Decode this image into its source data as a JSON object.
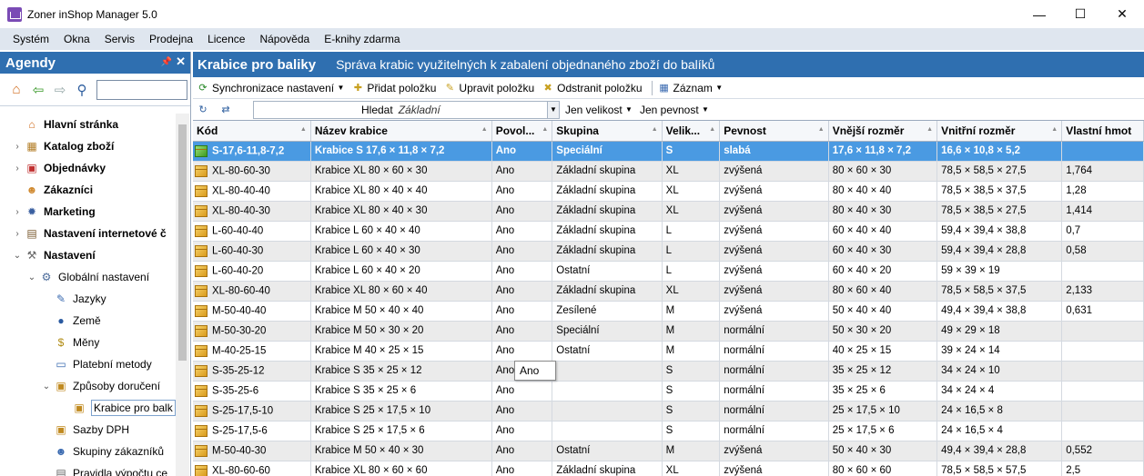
{
  "window": {
    "title": "Zoner inShop Manager 5.0",
    "minimize": "—",
    "maximize": "☐",
    "close": "✕"
  },
  "menu": [
    "Systém",
    "Okna",
    "Servis",
    "Prodejna",
    "Licence",
    "Nápověda",
    "E-knihy zdarma"
  ],
  "left_panel": {
    "title": "Agendy",
    "search_value": "",
    "tree": [
      {
        "label": "Hlavní stránka",
        "icon": "home-icon"
      },
      {
        "label": "Katalog zboží",
        "icon": "catalog-icon"
      },
      {
        "label": "Objednávky",
        "icon": "orders-icon"
      },
      {
        "label": "Zákazníci",
        "icon": "customers-icon"
      },
      {
        "label": "Marketing",
        "icon": "marketing-icon"
      },
      {
        "label": "Nastavení internetové č",
        "icon": "web-settings-icon"
      },
      {
        "label": "Nastavení",
        "icon": "settings-icon"
      },
      {
        "label": "Globální nastavení",
        "icon": "global-settings-icon"
      },
      {
        "label": "Jazyky",
        "icon": "languages-icon"
      },
      {
        "label": "Země",
        "icon": "globe-icon"
      },
      {
        "label": "Měny",
        "icon": "currency-icon"
      },
      {
        "label": "Platební metody",
        "icon": "payment-icon"
      },
      {
        "label": "Způsoby doručení",
        "icon": "delivery-icon"
      },
      {
        "label": "Krabice pro balk",
        "icon": "box-icon"
      },
      {
        "label": "Sazby DPH",
        "icon": "vat-icon"
      },
      {
        "label": "Skupiny zákazníků",
        "icon": "customer-groups-icon"
      },
      {
        "label": "Pravidla výpočtu ce",
        "icon": "price-rules-icon"
      }
    ]
  },
  "main": {
    "title": "Krabice pro baliky",
    "subtitle": "Správa krabic využitelných k zabalení objednaného zboží do balíků",
    "toolbar": {
      "sync": "Synchronizace nastavení",
      "add": "Přidat položku",
      "edit": "Upravit položku",
      "delete": "Odstranit položku",
      "record": "Záznam"
    },
    "filter": {
      "search_label": "Hledat",
      "search_value": "Základní",
      "only_size": "Jen velikost",
      "only_strength": "Jen pevnost"
    },
    "columns": [
      "Kód",
      "Název krabice",
      "Povol...",
      "Skupina",
      "Velik...",
      "Pevnost",
      "Vnější rozměr",
      "Vnitřní rozměr",
      "Vlastní hmot"
    ],
    "rows": [
      [
        "S-17,6-11,8-7,2",
        "Krabice S 17,6 × 11,8 × 7,2",
        "Ano",
        "Speciální",
        "S",
        "slabá",
        "17,6 × 11,8 × 7,2",
        "16,6 × 10,8 × 5,2",
        ""
      ],
      [
        "XL-80-60-30",
        "Krabice XL 80 × 60 × 30",
        "Ano",
        "Základní skupina",
        "XL",
        "zvýšená",
        "80 × 60 × 30",
        "78,5 × 58,5 × 27,5",
        "1,764"
      ],
      [
        "XL-80-40-40",
        "Krabice XL 80 × 40 × 40",
        "Ano",
        "Základní skupina",
        "XL",
        "zvýšená",
        "80 × 40 × 40",
        "78,5 × 38,5 × 37,5",
        "1,28"
      ],
      [
        "XL-80-40-30",
        "Krabice XL 80 × 40 × 30",
        "Ano",
        "Základní skupina",
        "XL",
        "zvýšená",
        "80 × 40 × 30",
        "78,5 × 38,5 × 27,5",
        "1,414"
      ],
      [
        "L-60-40-40",
        "Krabice L 60 × 40 × 40",
        "Ano",
        "Základní skupina",
        "L",
        "zvýšená",
        "60 × 40 × 40",
        "59,4 × 39,4 × 38,8",
        "0,7"
      ],
      [
        "L-60-40-30",
        "Krabice L 60 × 40 × 30",
        "Ano",
        "Základní skupina",
        "L",
        "zvýšená",
        "60 × 40 × 30",
        "59,4 × 39,4 × 28,8",
        "0,58"
      ],
      [
        "L-60-40-20",
        "Krabice L 60 × 40 × 20",
        "Ano",
        "Ostatní",
        "L",
        "zvýšená",
        "60 × 40 × 20",
        "59 × 39 × 19",
        ""
      ],
      [
        "XL-80-60-40",
        "Krabice XL 80 × 60 × 40",
        "Ano",
        "Základní skupina",
        "XL",
        "zvýšená",
        "80 × 60 × 40",
        "78,5 × 58,5 × 37,5",
        "2,133"
      ],
      [
        "M-50-40-40",
        "Krabice M 50 × 40 × 40",
        "Ano",
        "Zesílené",
        "M",
        "zvýšená",
        "50 × 40 × 40",
        "49,4 × 39,4 × 38,8",
        "0,631"
      ],
      [
        "M-50-30-20",
        "Krabice M 50 × 30 × 20",
        "Ano",
        "Speciální",
        "M",
        "normální",
        "50 × 30 × 20",
        "49 × 29 × 18",
        ""
      ],
      [
        "M-40-25-15",
        "Krabice M 40 × 25 × 15",
        "Ano",
        "Ostatní",
        "M",
        "normální",
        "40 × 25 × 15",
        "39 × 24 × 14",
        ""
      ],
      [
        "S-35-25-12",
        "Krabice S 35 × 25 × 12",
        "Ano",
        "",
        "S",
        "normální",
        "35 × 25 × 12",
        "34 × 24 × 10",
        ""
      ],
      [
        "S-35-25-6",
        "Krabice S 35 × 25 × 6",
        "Ano",
        "",
        "S",
        "normální",
        "35 × 25 × 6",
        "34 × 24 × 4",
        ""
      ],
      [
        "S-25-17,5-10",
        "Krabice S 25 × 17,5 × 10",
        "Ano",
        "",
        "S",
        "normální",
        "25 × 17,5 × 10",
        "24 × 16,5 × 8",
        ""
      ],
      [
        "S-25-17,5-6",
        "Krabice S 25 × 17,5 × 6",
        "Ano",
        "",
        "S",
        "normální",
        "25 × 17,5 × 6",
        "24 × 16,5 × 4",
        ""
      ],
      [
        "M-50-40-30",
        "Krabice M 50 × 40 × 30",
        "Ano",
        "Ostatní",
        "M",
        "zvýšená",
        "50 × 40 × 30",
        "49,4 × 39,4 × 28,8",
        "0,552"
      ],
      [
        "XL-80-60-60",
        "Krabice XL 80 × 60 × 60",
        "Ano",
        "Základní skupina",
        "XL",
        "zvýšená",
        "80 × 60 × 60",
        "78,5 × 58,5 × 57,5",
        "2,5"
      ]
    ],
    "tooltip": "Ano"
  },
  "colors": {
    "header_blue": "#2f6fb0",
    "selected_row": "#4a9ae2",
    "menu_bar": "#dfe6ef",
    "alt_row": "#ebebeb"
  }
}
